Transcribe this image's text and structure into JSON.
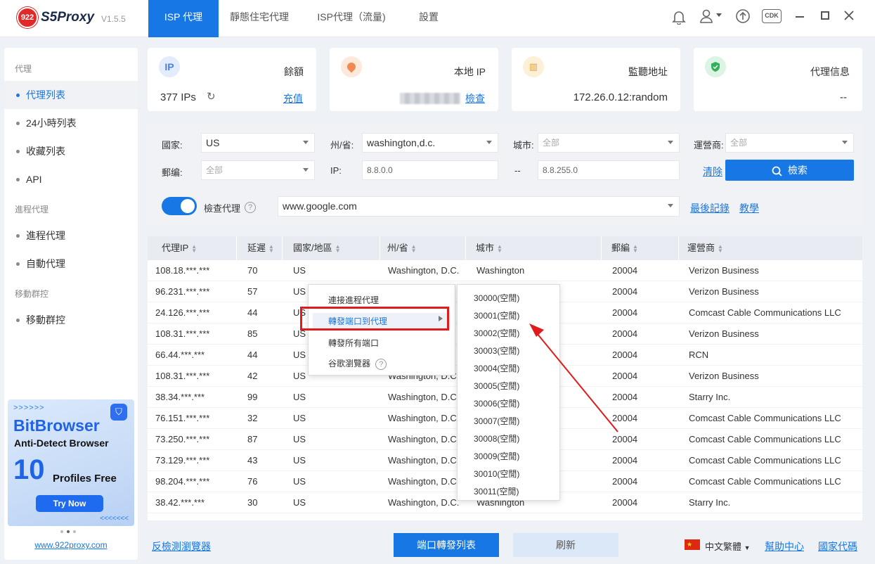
{
  "app": {
    "logo_badge": "922",
    "name": "S5Proxy",
    "version": "V1.5.5",
    "tabs": [
      {
        "label": "ISP 代理",
        "active": true
      },
      {
        "label": "靜態住宅代理",
        "active": false
      },
      {
        "label": "ISP代理（流量)",
        "active": false
      },
      {
        "label": "設置",
        "active": false
      }
    ],
    "toolbar_icons": [
      "bell-icon",
      "user-icon",
      "upload-icon",
      "cdk-icon",
      "minimize-icon",
      "maximize-icon",
      "close-icon"
    ],
    "cdk_label": "CDK"
  },
  "sidebar": {
    "group_proxy": "代理",
    "items_proxy": [
      "代理列表",
      "24小時列表",
      "收藏列表",
      "API"
    ],
    "group_process": "進程代理",
    "items_process": [
      "進程代理",
      "自動代理"
    ],
    "group_mobile": "移動群控",
    "items_mobile": [
      "移動群控"
    ],
    "active_item": "代理列表",
    "banner": {
      "arrows": ">>>>>>",
      "title": "BitBrowser",
      "subtitle": "Anti-Detect Browser",
      "number": "10",
      "profiles": "Profiles Free",
      "button": "Try Now",
      "arrows2": "<<<<<<<"
    },
    "website": "www.922proxy.com"
  },
  "cards": {
    "balance": {
      "icon": "IP",
      "label": "餘額",
      "value": "377 IPs",
      "link": "充值"
    },
    "local_ip": {
      "label": "本地 IP",
      "link": "檢查"
    },
    "listen": {
      "label": "監聽地址",
      "value": "172.26.0.12:random"
    },
    "info": {
      "label": "代理信息",
      "value": "--"
    }
  },
  "filters": {
    "country_label": "國家:",
    "country_value": "US",
    "state_label": "州/省:",
    "state_value": "washington,d.c.",
    "city_label": "城市:",
    "city_placeholder": "全部",
    "isp_label": "運營商:",
    "isp_placeholder": "全部",
    "zip_label": "郵编:",
    "zip_placeholder": "全部",
    "ip_label": "IP:",
    "ip_from": "8.8.0.0",
    "ip_sep": "--",
    "ip_to": "8.8.255.0",
    "clear": "清除",
    "search": "檢索",
    "check_label": "檢查代理",
    "check_url": "www.google.com",
    "last_record": "最後記錄",
    "tutorial": "教學"
  },
  "table": {
    "headers": [
      "代理IP",
      "延遲",
      "國家/地區",
      "州/省",
      "城市",
      "郵編",
      "運營商"
    ],
    "rows": [
      [
        "108.18.***.***",
        "70",
        "US",
        "Washington, D.C.",
        "Washington",
        "20004",
        "Verizon Business"
      ],
      [
        "96.231.***.***",
        "57",
        "US",
        "",
        "",
        "20004",
        "Verizon Business"
      ],
      [
        "24.126.***.***",
        "44",
        "US",
        "",
        "",
        "20004",
        "Comcast Cable Communications LLC"
      ],
      [
        "108.31.***.***",
        "85",
        "US",
        "",
        "",
        "20004",
        "Verizon Business"
      ],
      [
        "66.44.***.***",
        "44",
        "US",
        "",
        "",
        "20004",
        "RCN"
      ],
      [
        "108.31.***.***",
        "42",
        "US",
        "Washington, D.C",
        "",
        "20004",
        "Verizon Business"
      ],
      [
        "38.34.***.***",
        "99",
        "US",
        "Washington, D.C",
        "",
        "20004",
        "Starry Inc."
      ],
      [
        "76.151.***.***",
        "32",
        "US",
        "Washington, D.C",
        "",
        "20004",
        "Comcast Cable Communications LLC"
      ],
      [
        "73.250.***.***",
        "87",
        "US",
        "Washington, D.C",
        "",
        "20004",
        "Comcast Cable Communications LLC"
      ],
      [
        "73.129.***.***",
        "43",
        "US",
        "Washington, D.C",
        "",
        "20004",
        "Comcast Cable Communications LLC"
      ],
      [
        "98.204.***.***",
        "76",
        "US",
        "Washington, D.C",
        "",
        "20004",
        "Comcast Cable Communications LLC"
      ],
      [
        "38.42.***.***",
        "30",
        "US",
        "Washington, D.C.",
        "Washington",
        "20004",
        "Starry Inc."
      ]
    ]
  },
  "context_menu": {
    "items": [
      "連接進程代理",
      "轉發端口到代理",
      "轉發所有端口",
      "谷歌瀏覽器"
    ],
    "highlighted": "轉發端口到代理"
  },
  "port_submenu": [
    "30000(空閒)",
    "30001(空閒)",
    "30002(空閒)",
    "30003(空閒)",
    "30004(空閒)",
    "30005(空閒)",
    "30006(空閒)",
    "30007(空閒)",
    "30008(空閒)",
    "30009(空閒)",
    "30010(空閒)",
    "30011(空閒)"
  ],
  "footer": {
    "anti_detect": "反檢測瀏覽器",
    "port_list": "端口轉發列表",
    "refresh": "刷新",
    "language": "中文繁體",
    "help": "幫助中心",
    "country_code": "國家代碼"
  },
  "colors": {
    "accent": "#1677e5",
    "annotation": "#e01b1b"
  }
}
